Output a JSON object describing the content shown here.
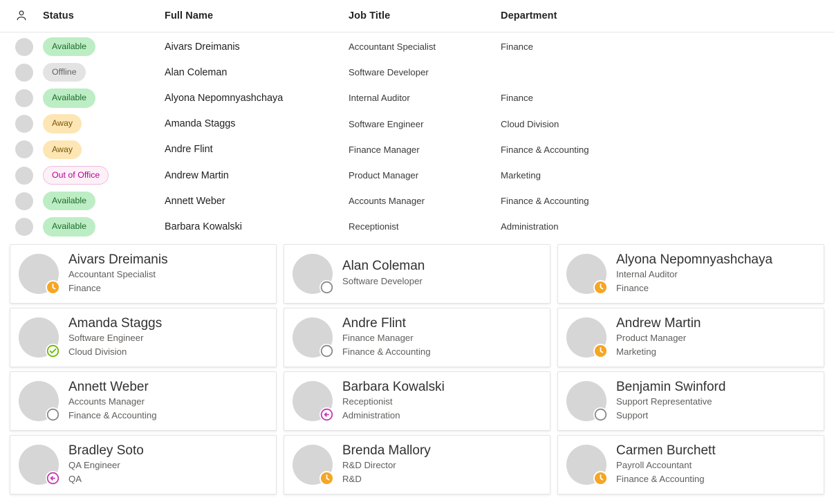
{
  "table": {
    "header_icon": "contact-person-icon",
    "columns": [
      "Status",
      "Full Name",
      "Job Title",
      "Department"
    ],
    "rows": [
      {
        "status": "Available",
        "status_kind": "available",
        "name": "Aivars Dreimanis",
        "job": "Accountant Specialist",
        "dept": "Finance"
      },
      {
        "status": "Offline",
        "status_kind": "offline",
        "name": "Alan Coleman",
        "job": "Software Developer",
        "dept": ""
      },
      {
        "status": "Available",
        "status_kind": "available",
        "name": "Alyona Nepomnyashchaya",
        "job": "Internal Auditor",
        "dept": "Finance"
      },
      {
        "status": "Away",
        "status_kind": "away",
        "name": "Amanda Staggs",
        "job": "Software Engineer",
        "dept": "Cloud Division"
      },
      {
        "status": "Away",
        "status_kind": "away",
        "name": "Andre Flint",
        "job": "Finance Manager",
        "dept": "Finance & Accounting"
      },
      {
        "status": "Out of Office",
        "status_kind": "outofoffice",
        "name": "Andrew Martin",
        "job": "Product Manager",
        "dept": "Marketing"
      },
      {
        "status": "Available",
        "status_kind": "available",
        "name": "Annett Weber",
        "job": "Accounts Manager",
        "dept": "Finance & Accounting"
      },
      {
        "status": "Available",
        "status_kind": "available",
        "name": "Barbara Kowalski",
        "job": "Receptionist",
        "dept": "Administration"
      }
    ]
  },
  "cards": [
    {
      "name": "Aivars Dreimanis",
      "job": "Accountant Specialist",
      "dept": "Finance",
      "presence": "away",
      "presence_icon": "clock-icon"
    },
    {
      "name": "Alan Coleman",
      "job": "Software Developer",
      "dept": "",
      "presence": "offline",
      "presence_icon": "circle-outline-icon"
    },
    {
      "name": "Alyona Nepomnyashchaya",
      "job": "Internal Auditor",
      "dept": "Finance",
      "presence": "away",
      "presence_icon": "clock-icon"
    },
    {
      "name": "Amanda Staggs",
      "job": "Software Engineer",
      "dept": "Cloud Division",
      "presence": "available",
      "presence_icon": "check-circle-icon"
    },
    {
      "name": "Andre Flint",
      "job": "Finance Manager",
      "dept": "Finance & Accounting",
      "presence": "offline",
      "presence_icon": "circle-outline-icon"
    },
    {
      "name": "Andrew Martin",
      "job": "Product Manager",
      "dept": "Marketing",
      "presence": "away",
      "presence_icon": "clock-icon"
    },
    {
      "name": "Annett Weber",
      "job": "Accounts Manager",
      "dept": "Finance & Accounting",
      "presence": "offline",
      "presence_icon": "circle-outline-icon"
    },
    {
      "name": "Barbara Kowalski",
      "job": "Receptionist",
      "dept": "Administration",
      "presence": "outofoffice",
      "presence_icon": "arrow-left-circle-icon"
    },
    {
      "name": "Benjamin Swinford",
      "job": "Support Representative",
      "dept": "Support",
      "presence": "offline",
      "presence_icon": "circle-outline-icon"
    },
    {
      "name": "Bradley Soto",
      "job": "QA Engineer",
      "dept": "QA",
      "presence": "outofoffice",
      "presence_icon": "arrow-left-circle-icon"
    },
    {
      "name": "Brenda Mallory",
      "job": "R&D Director",
      "dept": "R&D",
      "presence": "away",
      "presence_icon": "clock-icon"
    },
    {
      "name": "Carmen Burchett",
      "job": "Payroll Accountant",
      "dept": "Finance & Accounting",
      "presence": "away",
      "presence_icon": "clock-icon"
    }
  ],
  "colors": {
    "available_bg": "#bdedc4",
    "available_text": "#1d6a2a",
    "offline_bg": "#e3e3e3",
    "offline_text": "#60605f",
    "away_bg": "#fde6b4",
    "away_text": "#7a5605",
    "outofoffice_bg": "#fdf0f7",
    "outofoffice_text": "#b4009e",
    "presence_available": "#6bb700",
    "presence_away": "#f5a623",
    "presence_offline": "#8a8886",
    "presence_outofoffice": "#c239b3"
  },
  "avatar_palettes": [
    {
      "bg": "#cfc6ae",
      "hair": "#3b2a1d",
      "skin": "#d8a07a",
      "torso": "#4d4d52"
    },
    {
      "bg": "#cdcdcd",
      "hair": "#8c8c8c",
      "skin": "#d9b08e",
      "torso": "#2f3338"
    },
    {
      "bg": "#6d5a4a",
      "hair": "#a06a30",
      "skin": "#e2b391",
      "torso": "#3a2f28"
    },
    {
      "bg": "#c4cdd2",
      "hair": "#4b3322",
      "skin": "#e6b694",
      "torso": "#e4e7ea"
    },
    {
      "bg": "#8f9a72",
      "hair": "#6e5a3f",
      "skin": "#dca97f",
      "torso": "#3d4336"
    },
    {
      "bg": "#b9a98f",
      "hair": "#c58a42",
      "skin": "#e3b593",
      "torso": "#7d4a44"
    },
    {
      "bg": "#efe6e0",
      "hair": "#2d1d14",
      "skin": "#edc3a6",
      "torso": "#e9dcd4"
    },
    {
      "bg": "#c9a96b",
      "hair": "#b07c3a",
      "skin": "#e8bd96",
      "torso": "#b38f5e"
    },
    {
      "bg": "#9aa38f",
      "hair": "#5c4530",
      "skin": "#dcab84",
      "torso": "#46504a"
    },
    {
      "bg": "#8e8f85",
      "hair": "#463627",
      "skin": "#d2a07a",
      "torso": "#545a4d"
    },
    {
      "bg": "#d2d6d6",
      "hair": "#c2a264",
      "skin": "#e4bb9a",
      "torso": "#c6cccd"
    },
    {
      "bg": "#c2bcb2",
      "hair": "#9b7c4e",
      "skin": "#e7bc9a",
      "torso": "#b2aca2"
    }
  ]
}
